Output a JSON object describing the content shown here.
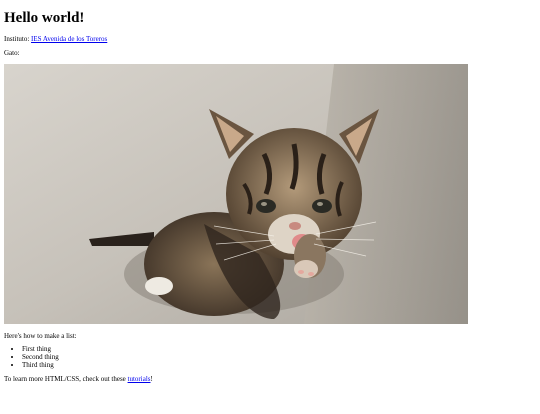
{
  "page": {
    "heading": "Hello world!",
    "institute_label": "Instituto: ",
    "institute_link": "IES Avenida de los Toreros",
    "cat_label": "Gato:",
    "list_intro": "Here's how to make a list:",
    "list_items": [
      "First thing",
      "Second thing",
      "Third thing"
    ],
    "learn_prefix": "To learn more HTML/CSS, check out these ",
    "learn_link": "tutorials",
    "learn_suffix": "!"
  },
  "image": {
    "subject": "kitten-photo",
    "colors": {
      "background": "#c9c4bc",
      "fur_dark": "#3a2e24",
      "fur_light": "#b9a48a",
      "tongue": "#e08a8a"
    }
  }
}
